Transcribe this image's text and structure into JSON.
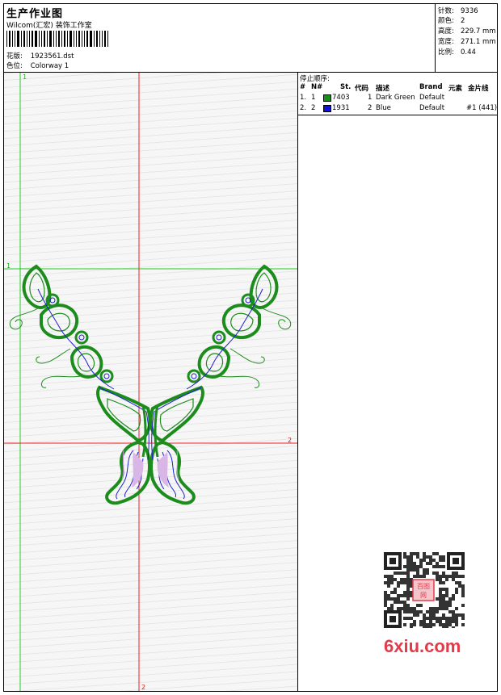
{
  "header": {
    "title": "生产作业图",
    "subtitle": "Wilcom(汇宏) 装饰工作室",
    "design_label": "花版:",
    "design_value": "1923561.dst",
    "colorway_label": "色位:",
    "colorway_value": "Colorway 1"
  },
  "stats": [
    {
      "label": "针数:",
      "value": "9336"
    },
    {
      "label": "颜色:",
      "value": "2"
    },
    {
      "label": "高度:",
      "value": "229.7 mm"
    },
    {
      "label": "宽度:",
      "value": "271.1 mm"
    },
    {
      "label": "比例:",
      "value": "0.44"
    }
  ],
  "stop_sequence": {
    "title": "停止顺序:",
    "columns": {
      "index": "#",
      "number": "N#",
      "stitch": "St.",
      "code": "代码",
      "description": "描述",
      "brand": "Brand",
      "element": "元素",
      "sequin": "金片线"
    },
    "rows": [
      {
        "index": "1.",
        "number": "1",
        "color": "#1c8c1c",
        "stitch": "7403",
        "code": "1",
        "description": "Dark Green",
        "brand": "Default",
        "element": "",
        "sequin": ""
      },
      {
        "index": "2.",
        "number": "2",
        "color": "#1010e0",
        "stitch": "1931",
        "code": "2",
        "description": "Blue",
        "brand": "Default",
        "element": "",
        "sequin": "#1 (441)"
      }
    ]
  },
  "canvas": {
    "guide_green_label_top": "1",
    "guide_green_label_left": "1",
    "guide_red_label_right": "2",
    "guide_red_label_bottom": "2",
    "guide_green_color": "#22cc22",
    "guide_red_color": "#ee2222",
    "thread_green": "#1c8c1c",
    "thread_blue": "#2020d0"
  },
  "watermark": {
    "qr_stamp": "百图网",
    "site": "6xiu.com",
    "color": "#e23b4a"
  }
}
